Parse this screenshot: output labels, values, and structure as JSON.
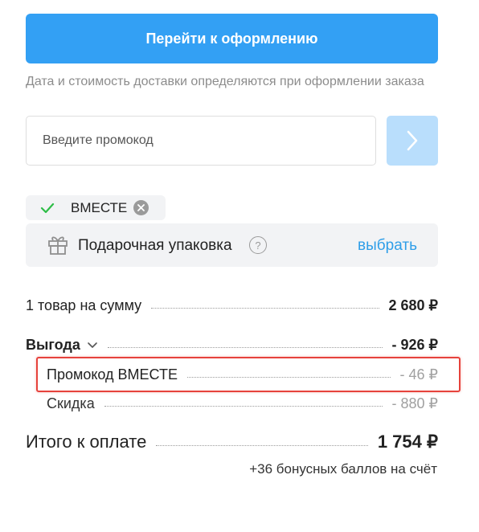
{
  "checkout": {
    "button_label": "Перейти к оформлению"
  },
  "delivery_note": "Дата и стоимость доставки определяются при оформлении заказа",
  "promo": {
    "placeholder": "Введите промокод",
    "submit_icon": "chevron-right-icon",
    "applied_code": "ВМЕСТЕ"
  },
  "gift_wrap": {
    "label": "Подарочная упаковка",
    "help": "?",
    "select_label": "выбрать"
  },
  "summary": {
    "items_label": "1 товар на сумму",
    "items_value": "2 680 ₽",
    "benefit_label": "Выгода",
    "benefit_value": "- 926 ₽",
    "promo_label": "Промокод ВМЕСТЕ",
    "promo_value": "- 46 ₽",
    "discount_label": "Скидка",
    "discount_value": "- 880 ₽",
    "total_label": "Итого к оплате",
    "total_value": "1 754 ₽",
    "bonus_note": "+36 бонусных баллов на счёт"
  },
  "colors": {
    "accent": "#33a0f4",
    "accent_light": "#b9defc",
    "link": "#2f9ee8",
    "highlight_border": "#e6423c",
    "check": "#2ebd47"
  }
}
